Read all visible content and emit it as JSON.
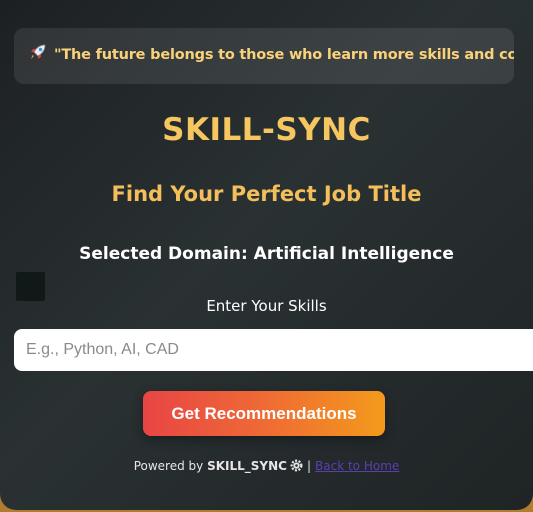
{
  "banner": {
    "icon": "rocket-icon",
    "quote": "\"The future belongs to those who learn more skills and combine them in creative ways.\""
  },
  "header": {
    "title": "SKILL-SYNC",
    "subtitle": "Find Your Perfect Job Title"
  },
  "domain": {
    "text": "Selected Domain: Artificial Intelligence"
  },
  "form": {
    "skills_label": "Enter Your Skills",
    "skills_placeholder": "E.g., Python, AI, CAD",
    "skills_value": "",
    "submit_label": "Get Recommendations"
  },
  "footer": {
    "powered_by": "Powered by",
    "brand": "SKILL_SYNC",
    "brand_icon": "gear-icon",
    "separator": "|",
    "back_link": "Back to Home"
  },
  "colors": {
    "accent_gold": "#f6c660",
    "button_start": "#e84545",
    "button_end": "#f49a1b",
    "card_bg": "#2a3133",
    "link": "#5b3fb0"
  }
}
